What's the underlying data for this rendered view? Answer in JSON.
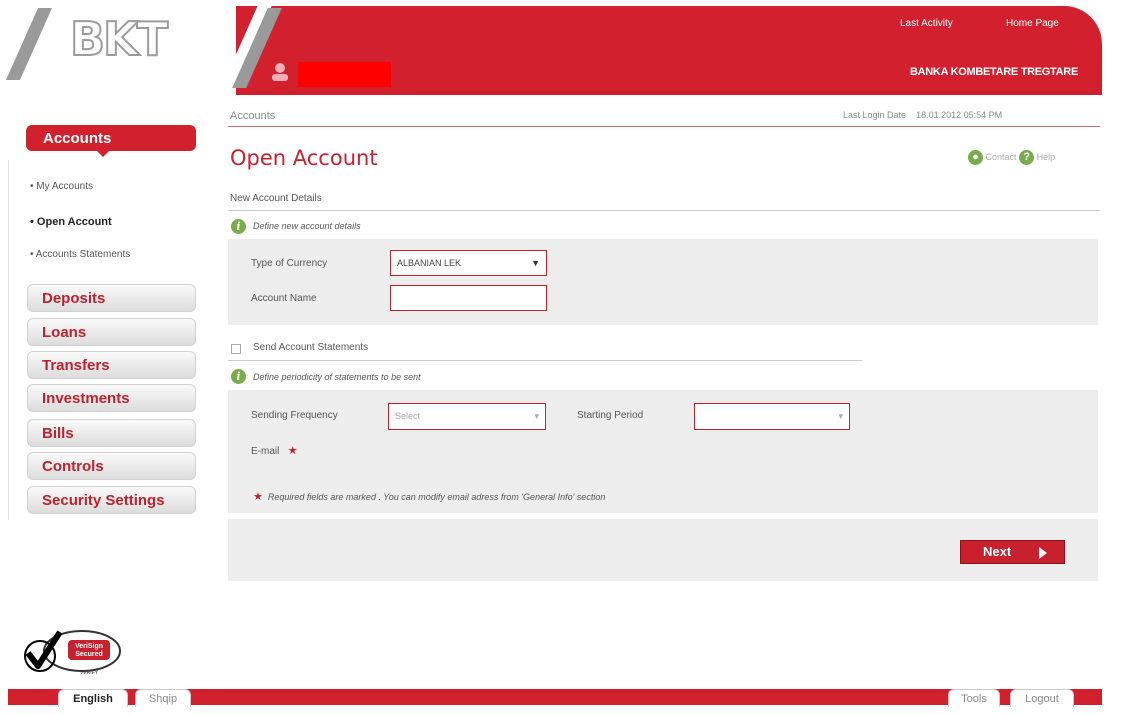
{
  "header": {
    "logo": "BKT",
    "last_activity": "Last Activity",
    "home_page": "Home Page",
    "bank_name": "BANKA KOMBETARE TREGTARE"
  },
  "breadcrumb": "Accounts",
  "last_login": {
    "label": "Last Login Date",
    "value": "18.01.2012 05:54 PM"
  },
  "sidebar": {
    "active_section": "Accounts",
    "sub_items": [
      "My Accounts",
      "Open Account",
      "Accounts Statements"
    ],
    "active_sub": "Open Account",
    "menu": [
      "Deposits",
      "Loans",
      "Transfers",
      "Investments",
      "Bills",
      "Controls",
      "Security Settings"
    ]
  },
  "page": {
    "title": "Open Account",
    "contact": "Contact",
    "help": "Help",
    "section_title": "New Account Details",
    "define_details": "Define new account details",
    "currency_label": "Type of Currency",
    "currency_value": "ALBANIAN LEK",
    "account_name_label": "Account Name",
    "account_name_value": "",
    "send_statements": "Send Account Statements",
    "define_periodicity": "Define periodicity of statements to be sent",
    "frequency_label": "Sending Frequency",
    "frequency_value": "Select",
    "starting_period_label": "Starting Period",
    "starting_period_value": "",
    "email_label": "E-mail",
    "required_note": "Required fields are marked . You can modify email adress from 'General Info' section",
    "next": "Next"
  },
  "footer": {
    "lang_en": "English",
    "lang_sq": "Shqip",
    "tools": "Tools",
    "logout": "Logout",
    "verisign": "VeriSign Secured",
    "verify": "VERIFY"
  },
  "colors": {
    "brand_red": "#d3202e",
    "info_green": "#7aac4c"
  }
}
